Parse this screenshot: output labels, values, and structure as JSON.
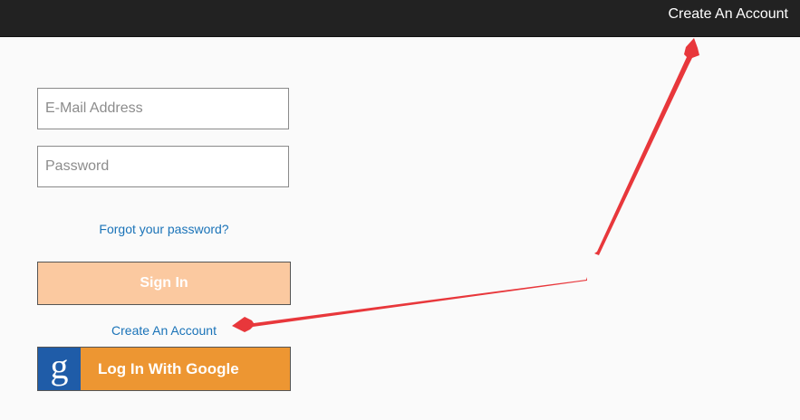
{
  "header": {
    "create_account_label": "Create An Account"
  },
  "login_form": {
    "email_placeholder": "E-Mail Address",
    "password_placeholder": "Password",
    "forgot_password_label": "Forgot your password?",
    "sign_in_label": "Sign In",
    "create_account_label": "Create An Account",
    "google_button_label": "Log In With Google",
    "google_icon_glyph": "g"
  },
  "colors": {
    "topbar": "#222222",
    "link": "#1a73b8",
    "sign_in_button": "#fbc9a0",
    "google_button": "#ed9632",
    "google_icon_bg": "#1f5ca8",
    "annotation_arrow": "#e8373b"
  },
  "icons": {
    "google": "google-g-icon",
    "annotation": "red-arrow"
  }
}
